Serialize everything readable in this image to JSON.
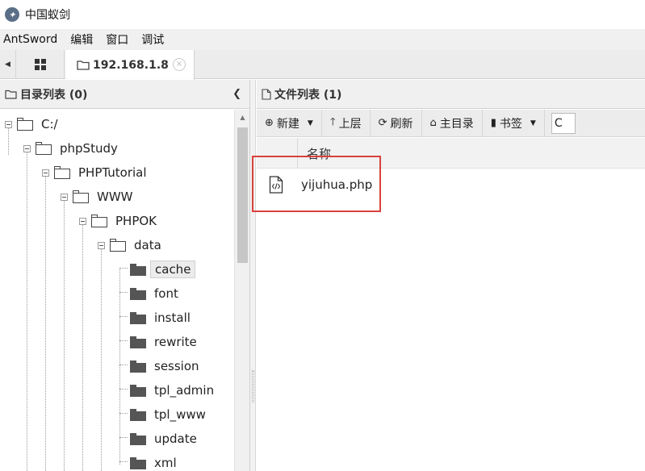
{
  "window": {
    "title": "中国蚁剑",
    "logo_icon": "antsword-logo-icon"
  },
  "menubar": {
    "items": [
      "AntSword",
      "编辑",
      "窗口",
      "调试"
    ]
  },
  "tabs": {
    "active_label": "192.168.1.8",
    "close_glyph": "×"
  },
  "left_panel": {
    "title": "目录列表 (0)",
    "tree": [
      {
        "label": "C:/"
      },
      {
        "label": "phpStudy"
      },
      {
        "label": "PHPTutorial"
      },
      {
        "label": "WWW"
      },
      {
        "label": "PHPOK"
      },
      {
        "label": "data"
      },
      {
        "label": "cache",
        "selected": true
      },
      {
        "label": "font"
      },
      {
        "label": "install"
      },
      {
        "label": "rewrite"
      },
      {
        "label": "session"
      },
      {
        "label": "tpl_admin"
      },
      {
        "label": "tpl_www"
      },
      {
        "label": "update"
      },
      {
        "label": "xml"
      }
    ]
  },
  "right_panel": {
    "title": "文件列表 (1)",
    "toolbar": {
      "new_label": "新建",
      "up_label": "上层",
      "refresh_label": "刷新",
      "home_label": "主目录",
      "bookmark_label": "书签",
      "path_value": "C"
    },
    "columns": {
      "name": "名称"
    },
    "files": [
      {
        "name": "yijuhua.php",
        "icon": "php-file-icon"
      }
    ]
  },
  "colors": {
    "highlight_box": "#d9413c"
  }
}
